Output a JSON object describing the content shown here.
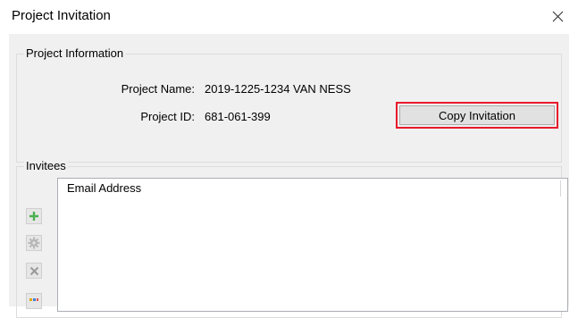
{
  "window": {
    "title": "Project Invitation",
    "close_icon": "close-icon"
  },
  "project_info": {
    "group_label": "Project Information",
    "name_label": "Project Name:",
    "name_value": "2019-1225-1234 VAN NESS",
    "id_label": "Project ID:",
    "id_value": "681-061-399",
    "copy_button_label": "Copy Invitation",
    "highlight_color": "#e8192c"
  },
  "invitees": {
    "group_label": "Invitees",
    "toolbar": [
      {
        "icon": "add-icon",
        "color": "#4caf50"
      },
      {
        "icon": "gear-icon",
        "color": "#b0b0b0"
      },
      {
        "icon": "remove-icon",
        "color": "#9e9e9e"
      },
      {
        "icon": "address-book-icon",
        "color": "#e0a800"
      }
    ],
    "columns": [
      "Email Address"
    ]
  }
}
